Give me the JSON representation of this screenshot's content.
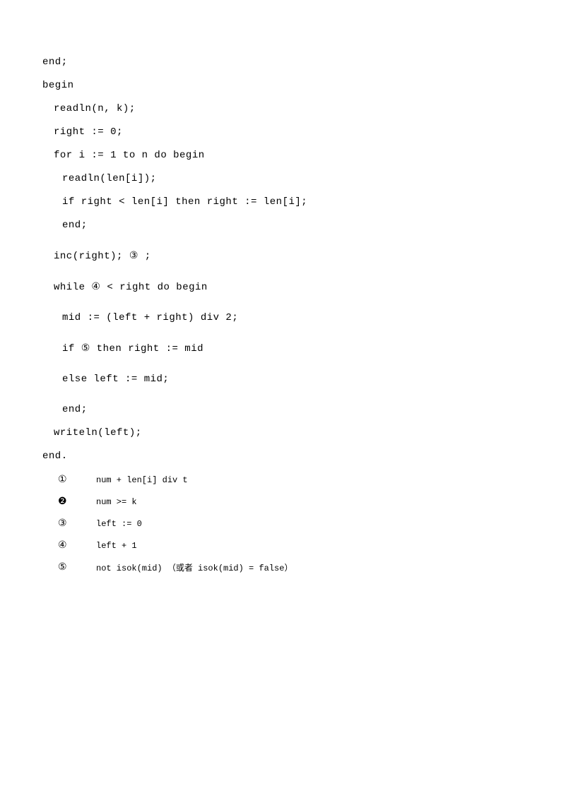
{
  "code": {
    "l1": "end;",
    "l2": "begin",
    "l3": "readln(n, k);",
    "l4": "right := 0;",
    "l5": "for i := 1 to n do begin",
    "l6": "readln(len[i]);",
    "l7": "if right < len[i] then right := len[i];",
    "l8": "end;",
    "l9a": "inc(right); ",
    "l9c": " ;",
    "l10a": "while ",
    "l10c": " < right do begin",
    "l11": "mid := (left + right) div 2;",
    "l12a": "if ",
    "l12c": " then right := mid",
    "l13": "else left := mid;",
    "l14": "end;",
    "l15": "writeln(left);",
    "l16": "end."
  },
  "markers": {
    "m1": "①",
    "m2": "❷",
    "m3": "③",
    "m4": "④",
    "m5": "⑤"
  },
  "answers": {
    "a1": "num + len[i] div t",
    "a2": "num >= k",
    "a3": "left := 0",
    "a4": "left + 1",
    "a5": "not isok(mid) （或者 isok(mid) = false）"
  }
}
